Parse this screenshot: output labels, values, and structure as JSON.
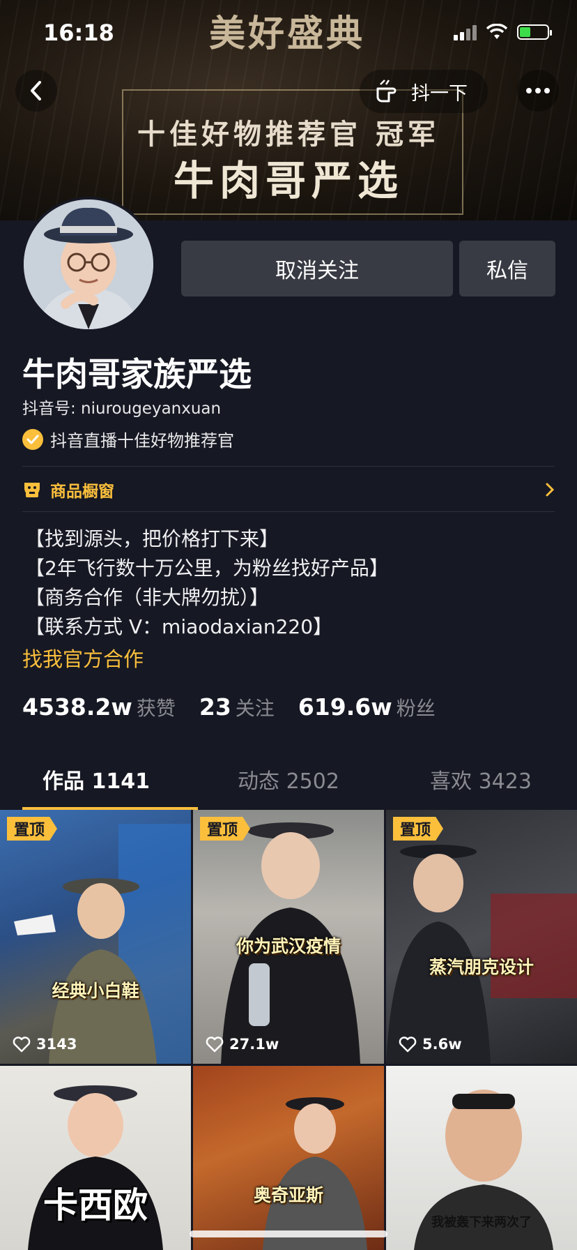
{
  "status_bar": {
    "time": "16:18"
  },
  "banner": {
    "top_text": "美好盛典",
    "line1": "十佳好物推荐官 冠军",
    "line2": "牛肉哥严选"
  },
  "header": {
    "shake_label": "抖一下"
  },
  "profile": {
    "follow_button": "取消关注",
    "message_button": "私信",
    "name": "牛肉哥家族严选",
    "douyin_id": "抖音号: niurougeyanxuan",
    "verification": "抖音直播十佳好物推荐官",
    "shop_label": "商品橱窗",
    "bio": [
      "【找到源头，把价格打下来】",
      "【2年飞行数十万公里，为粉丝找好产品】",
      "【商务合作（非大牌勿扰）】",
      "【联系方式 V：miaodaxian220】"
    ],
    "official_link": "找我官方合作",
    "stats": [
      {
        "value": "4538.2w",
        "label": "获赞"
      },
      {
        "value": "23",
        "label": "关注"
      },
      {
        "value": "619.6w",
        "label": "粉丝"
      }
    ]
  },
  "tabs": [
    {
      "label": "作品 1141",
      "active": true
    },
    {
      "label": "动态 2502",
      "active": false
    },
    {
      "label": "喜欢 3423",
      "active": false
    }
  ],
  "videos": [
    {
      "pinned": "置顶",
      "caption": "经典小白鞋",
      "likes": "3143"
    },
    {
      "pinned": "置顶",
      "caption": "你为武汉疫情",
      "likes": "27.1w"
    },
    {
      "pinned": "置顶",
      "caption": "蒸汽朋克设计",
      "likes": "5.6w"
    },
    {
      "caption": "卡西欧"
    },
    {
      "caption": "奥奇亚斯"
    },
    {
      "caption": "我被轰下来两次了"
    }
  ],
  "colors": {
    "accent": "#fbbf3c",
    "background": "#161823",
    "button": "#393b44"
  }
}
